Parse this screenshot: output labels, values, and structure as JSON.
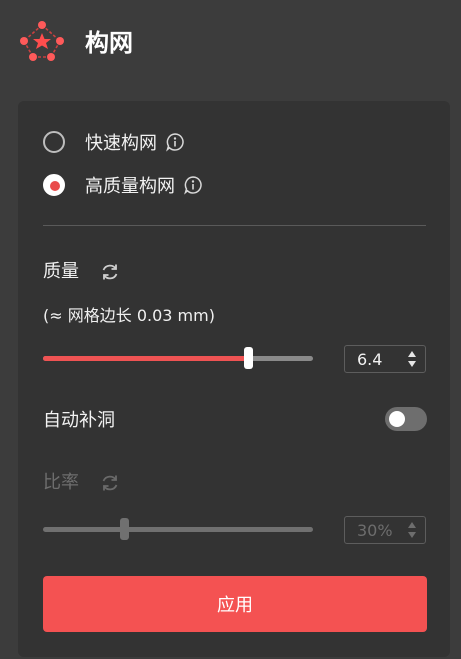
{
  "header": {
    "title": "构网"
  },
  "mesh_mode": {
    "options": [
      {
        "label": "快速构网",
        "selected": false
      },
      {
        "label": "高质量构网",
        "selected": true
      }
    ]
  },
  "quality": {
    "label": "质量",
    "hint": "(≈ 网格边长 0.03 mm)",
    "slider_fraction": 0.76,
    "value": "6.4"
  },
  "auto_fill": {
    "label": "自动补洞",
    "enabled": false
  },
  "ratio": {
    "label": "比率",
    "disabled": true,
    "slider_fraction": 0.3,
    "value": "30%"
  },
  "apply_button": {
    "label": "应用"
  },
  "colors": {
    "accent": "#f45252",
    "panel": "#333333",
    "background": "#3c3c3c"
  }
}
